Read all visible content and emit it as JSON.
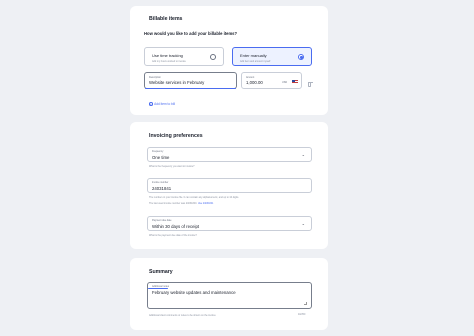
{
  "billable": {
    "title": "Billable items",
    "question": "How would you like to add your billable items?",
    "options": [
      {
        "label": "Use time tracking",
        "sub": "Add my hours worked to invoice",
        "selected": false
      },
      {
        "label": "Enter manually",
        "sub": "Add item and amount myself",
        "selected": true
      }
    ],
    "description": {
      "label": "Description",
      "value": "Website services in February"
    },
    "amount": {
      "label": "Amount",
      "value": "1,000.00",
      "currency": "USD"
    },
    "add_item": "Add item to bill"
  },
  "invoicing": {
    "title": "Invoicing preferences",
    "frequency": {
      "label": "Frequency",
      "value": "One time",
      "help": "What is the frequency you want to invoice?"
    },
    "invoice_number": {
      "label": "Invoice number",
      "value": "24031841",
      "help1": "The number on your invoice file. It can contain any alphanumeric, and up to 10 digits.",
      "help2_prefix": "The last used invoice number was",
      "help2_value": "24031840",
      "help2_link_prefix": "Use",
      "help2_link_value": "24031841"
    },
    "payment_due": {
      "label": "Payment due date",
      "value": "Within 30 days of receipt",
      "help": "What is the payment due date of the invoice?"
    }
  },
  "summary": {
    "title": "Summary",
    "notes": {
      "label": "Additional notes",
      "value": "February website updates and maintenance"
    },
    "help": "Additional client comments or notes to be shown on the invoice",
    "counter": "40/250"
  },
  "icons": {
    "chevron": "chevron-down-icon",
    "trash": "trash-icon",
    "plus": "plus-circle-icon",
    "flag": "us-flag-icon"
  },
  "colors": {
    "accent": "#4a6cf0",
    "background": "#eef0f4",
    "card": "#ffffff"
  }
}
